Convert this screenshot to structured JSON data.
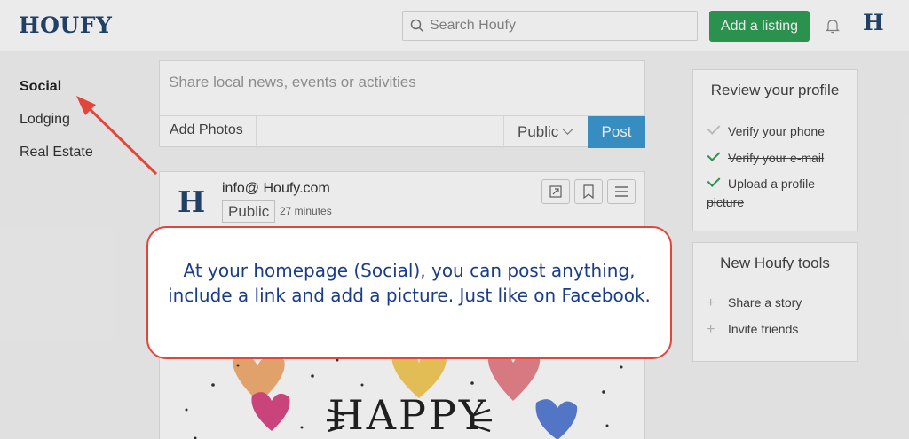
{
  "header": {
    "logo": "HOUFY",
    "search_placeholder": "Search Houfy",
    "add_listing_label": "Add a listing",
    "avatar_letter": "H"
  },
  "leftnav": {
    "items": [
      {
        "label": "Social",
        "active": true
      },
      {
        "label": "Lodging",
        "active": false
      },
      {
        "label": "Real Estate",
        "active": false
      }
    ]
  },
  "composer": {
    "placeholder": "Share local news, events or activities",
    "add_photos_label": "Add Photos",
    "visibility": "Public",
    "post_label": "Post"
  },
  "post": {
    "avatar_letter": "H",
    "author": "info@ Houfy.com",
    "visibility": "Public",
    "time": "27 minutes",
    "image_text": "HAPPY"
  },
  "review_card": {
    "title": "Review your profile",
    "items": [
      {
        "label": "Verify your phone",
        "done": false
      },
      {
        "label": "Verify your e-mail",
        "done": true
      },
      {
        "label": "Upload a profile picture",
        "done": true
      }
    ]
  },
  "tools_card": {
    "title": "New Houfy tools",
    "items": [
      {
        "label": "Share a story"
      },
      {
        "label": "Invite friends"
      }
    ]
  },
  "callout": {
    "text": "At your homepage (Social), you can post anything, include a link and add a picture. Just like on Facebook."
  },
  "colors": {
    "brand_navy": "#24466f",
    "listing_green": "#2f9e55",
    "post_blue": "#3d9ad1",
    "callout_red": "#e2463b",
    "callout_text": "#1a3d8a"
  }
}
